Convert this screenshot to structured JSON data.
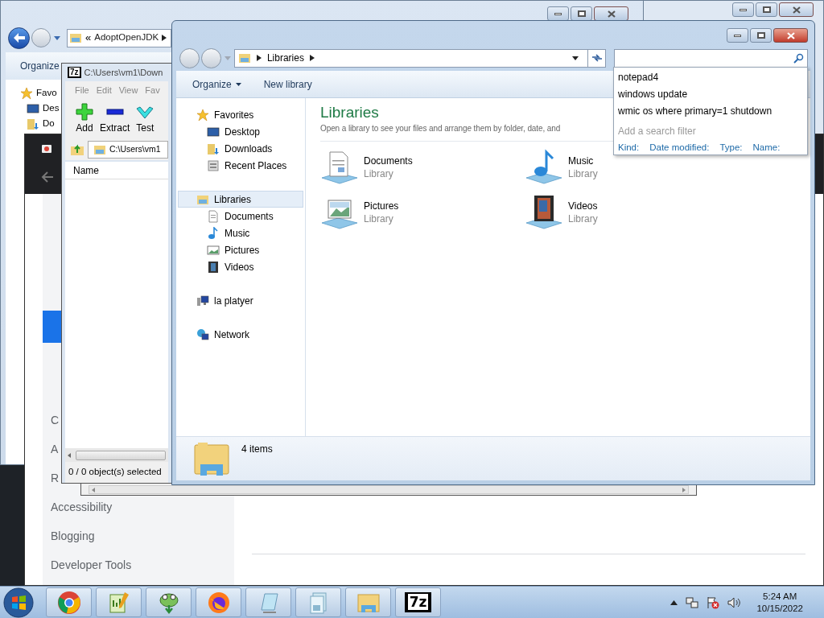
{
  "back_explorer": {
    "address_prefix": "«",
    "address": "AdoptOpenJDK",
    "toolbar": [
      "Organize"
    ],
    "sidebar": [
      {
        "label": "Favo",
        "kind": "star"
      },
      {
        "label": "Des",
        "kind": "desktop"
      },
      {
        "label": "Do",
        "kind": "downloads"
      }
    ]
  },
  "browser": {
    "sidebar": [
      {
        "label": "C"
      },
      {
        "label": "A"
      },
      {
        "label": "R"
      },
      {
        "label": "Accessibility"
      },
      {
        "label": "Blogging"
      },
      {
        "label": "Developer Tools"
      }
    ]
  },
  "sevenzip": {
    "logo": "7z",
    "title": "C:\\Users\\vm1\\Down",
    "menu": [
      "File",
      "Edit",
      "View",
      "Fav"
    ],
    "toolbar": [
      {
        "kind": "add",
        "label": "Add"
      },
      {
        "kind": "extract",
        "label": "Extract"
      },
      {
        "kind": "test",
        "label": "Test"
      }
    ],
    "path": "C:\\Users\\vm1",
    "column": "Name",
    "status": "0 / 0 object(s) selected"
  },
  "explorer": {
    "breadcrumb": "Libraries",
    "toolbar": [
      {
        "label": "Organize",
        "menu": true
      },
      {
        "label": "New library",
        "menu": false
      }
    ],
    "sidebar": [
      {
        "label": "Favorites",
        "kind": "star",
        "selected": false,
        "children": [
          {
            "label": "Desktop",
            "kind": "desktop",
            "selected": false
          },
          {
            "label": "Downloads",
            "kind": "downloads",
            "selected": false
          },
          {
            "label": "Recent Places",
            "kind": "recent",
            "selected": false
          }
        ]
      },
      {
        "label": "Libraries",
        "kind": "libraries",
        "selected": true,
        "children": [
          {
            "label": "Documents",
            "kind": "documents",
            "selected": false
          },
          {
            "label": "Music",
            "kind": "music",
            "selected": false
          },
          {
            "label": "Pictures",
            "kind": "pictures",
            "selected": false
          },
          {
            "label": "Videos",
            "kind": "videos",
            "selected": false
          }
        ]
      },
      {
        "label": "la platyer",
        "kind": "computer",
        "selected": false
      },
      {
        "label": "Network",
        "kind": "network",
        "selected": false
      }
    ],
    "heading": "Libraries",
    "description": "Open a library to see your files and arrange them by folder, date, and",
    "libraries": [
      {
        "name": "Documents",
        "type": "Library",
        "kind": "documents"
      },
      {
        "name": "Music",
        "type": "Library",
        "kind": "music"
      },
      {
        "name": "Pictures",
        "type": "Library",
        "kind": "pictures"
      },
      {
        "name": "Videos",
        "type": "Library",
        "kind": "videos"
      }
    ],
    "status": "4 items"
  },
  "search_dropdown": {
    "history": [
      "notepad4",
      "windows update",
      "wmic os where primary=1 shutdown"
    ],
    "filter_hint": "Add a search filter",
    "filters": [
      "Kind:",
      "Date modified:",
      "Type:",
      "Name:"
    ]
  },
  "taskbar": {
    "apps": [
      {
        "kind": "chrome"
      },
      {
        "kind": "notepadpp"
      },
      {
        "kind": "chameleon"
      },
      {
        "kind": "firefox"
      },
      {
        "kind": "notepad"
      },
      {
        "kind": "documents"
      },
      {
        "kind": "explorer"
      },
      {
        "kind": "sevenzip",
        "label": "7z"
      }
    ],
    "time": "5:24 AM",
    "date": "10/15/2022"
  }
}
